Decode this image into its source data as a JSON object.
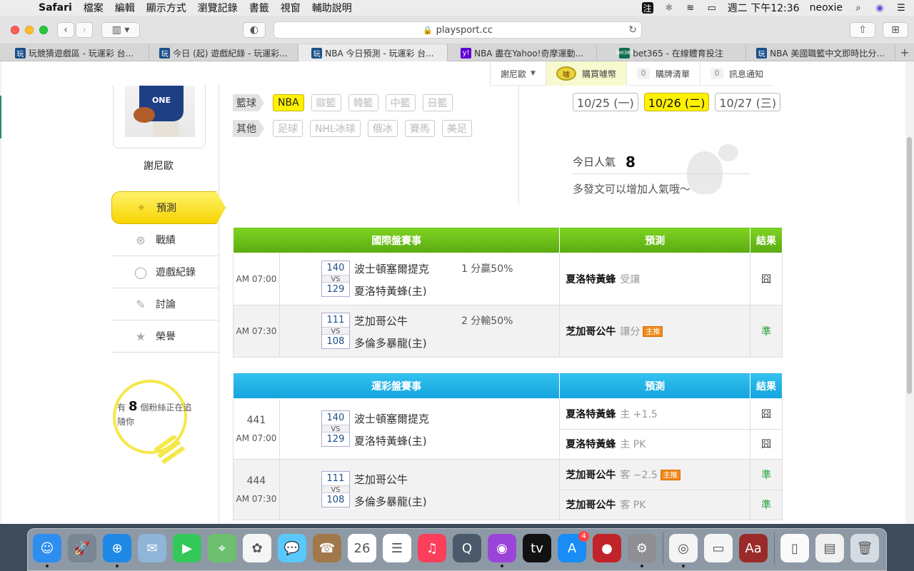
{
  "menubar": {
    "apple": "",
    "app_name": "Safari",
    "items": [
      "檔案",
      "編輯",
      "顯示方式",
      "瀏覽記錄",
      "書籤",
      "視窗",
      "輔助說明"
    ],
    "input_method": "注",
    "datetime": "週二 下午12:36",
    "user": "neoxie"
  },
  "browser": {
    "url": "playsport.cc",
    "tabs": [
      {
        "label": "玩競猜遊戲區 - 玩運彩 台...",
        "favicon": "wan-icon",
        "favicon_text": "玩"
      },
      {
        "label": "今日 (起) 遊戲紀錄 - 玩運彩...",
        "favicon": "wan-icon",
        "favicon_text": "玩"
      },
      {
        "label": "NBA 今日預測 - 玩運彩 台...",
        "favicon": "wan-icon",
        "favicon_text": "玩",
        "active": true
      },
      {
        "label": "NBA 盡在Yahoo!奇摩運動...",
        "favicon": "yahoo-icon",
        "favicon_text": "y!"
      },
      {
        "label": "bet365 - 在線體育投注",
        "favicon": "bet365-icon",
        "favicon_text": "bet365"
      },
      {
        "label": "NBA 美國職籃中文即時比分...",
        "favicon": "wan-icon",
        "favicon_text": "玩"
      }
    ]
  },
  "userbar": {
    "username": "謝尼歐",
    "buy_coins": "購買噱幣",
    "coin_icon_text": "噱",
    "cart_count": "0",
    "cart_label": "購牌清單",
    "notice_count": "0",
    "notice_label": "訊息通知"
  },
  "sidebar": {
    "jersey_text": "ONE",
    "username": "謝尼歐",
    "nav": [
      {
        "label": "預測",
        "icon": "target-icon",
        "active": true
      },
      {
        "label": "戰績",
        "icon": "record-icon"
      },
      {
        "label": "遊戲紀錄",
        "icon": "circle-icon"
      },
      {
        "label": "討論",
        "icon": "discuss-icon"
      },
      {
        "label": "榮譽",
        "icon": "medal-icon"
      }
    ],
    "fans": {
      "prefix": "有",
      "count": "8",
      "suffix": "個粉絲正在追隨你"
    }
  },
  "filters": {
    "basketball": {
      "category": "籃球",
      "items": [
        "NBA",
        "歐籃",
        "韓籃",
        "中籃",
        "日籃"
      ],
      "active": "NBA"
    },
    "other": {
      "category": "其他",
      "items": [
        "足球",
        "NHL冰球",
        "俄冰",
        "賽馬",
        "美足"
      ]
    }
  },
  "dates": [
    {
      "label": "10/25 (一)"
    },
    {
      "label": "10/26 (二)",
      "active": true
    },
    {
      "label": "10/27 (三)"
    }
  ],
  "popularity": {
    "label": "今日人氣",
    "value": "8",
    "hint": "多發文可以增加人氣哦～"
  },
  "intl_table": {
    "headers": [
      "國際盤賽事",
      "預測",
      "結果"
    ],
    "rows": [
      {
        "time": "AM 07:00",
        "score1": "140",
        "score2": "129",
        "vs": "VS",
        "team1": "波士頓塞爾提克",
        "team2": "夏洛特黃蜂(主)",
        "odds": "1 分贏50%",
        "pred_team": "夏洛特黃蜂",
        "pred_detail": "受讓",
        "main": false,
        "result": "囧"
      },
      {
        "time": "AM 07:30",
        "score1": "111",
        "score2": "108",
        "vs": "VS",
        "team1": "芝加哥公牛",
        "team2": "多倫多暴龍(主)",
        "odds": "2 分輸50%",
        "pred_team": "芝加哥公牛",
        "pred_detail": "讓分",
        "main": true,
        "main_label": "主推",
        "result": "準"
      }
    ]
  },
  "lottery_table": {
    "headers": [
      "運彩盤賽事",
      "預測",
      "結果"
    ],
    "rows": [
      {
        "game_no": "441",
        "time": "AM 07:00",
        "score1": "140",
        "score2": "129",
        "vs": "VS",
        "team1": "波士頓塞爾提克",
        "team2": "夏洛特黃蜂(主)",
        "preds": [
          {
            "team": "夏洛特黃蜂",
            "detail": "主 +1.5",
            "main": false,
            "result": "囧"
          },
          {
            "team": "夏洛特黃蜂",
            "detail": "主 PK",
            "main": false,
            "result": "囧"
          }
        ]
      },
      {
        "game_no": "444",
        "time": "AM 07:30",
        "score1": "111",
        "score2": "108",
        "vs": "VS",
        "team1": "芝加哥公牛",
        "team2": "多倫多暴龍(主)",
        "preds": [
          {
            "team": "芝加哥公牛",
            "detail": "客 −2.5",
            "main": true,
            "main_label": "主推",
            "result": "準"
          },
          {
            "team": "芝加哥公牛",
            "detail": "客 PK",
            "main": false,
            "result": "準"
          }
        ]
      }
    ]
  },
  "dock": {
    "apps": [
      {
        "name": "finder-icon",
        "color": "#2d8ef0",
        "glyph": "☺",
        "running": true
      },
      {
        "name": "launchpad-icon",
        "color": "#7a8694",
        "glyph": "🚀",
        "running": false
      },
      {
        "name": "safari-icon",
        "color": "#1e88e5",
        "glyph": "⊕",
        "running": true
      },
      {
        "name": "mail-icon",
        "color": "#8fb6d9",
        "glyph": "✉",
        "running": false
      },
      {
        "name": "facetime-icon",
        "color": "#34c759",
        "glyph": "▶",
        "running": false
      },
      {
        "name": "maps-icon",
        "color": "#6cc070",
        "glyph": "⌖",
        "running": false
      },
      {
        "name": "photos-icon",
        "color": "#f5f5f5",
        "glyph": "✿",
        "running": false
      },
      {
        "name": "messages-icon",
        "color": "#5ac8fa",
        "glyph": "💬",
        "running": false
      },
      {
        "name": "contacts-icon",
        "color": "#a0784a",
        "glyph": "☎",
        "running": false
      },
      {
        "name": "calendar-icon",
        "color": "#ffffff",
        "glyph": "26",
        "running": false
      },
      {
        "name": "reminders-icon",
        "color": "#ffffff",
        "glyph": "☰",
        "running": false
      },
      {
        "name": "music-icon",
        "color": "#fa3e5c",
        "glyph": "♫",
        "running": false
      },
      {
        "name": "quicktime-icon",
        "color": "#4a5a6a",
        "glyph": "Q",
        "running": false
      },
      {
        "name": "podcasts-icon",
        "color": "#9b45d8",
        "glyph": "◉",
        "running": true
      },
      {
        "name": "tv-icon",
        "color": "#111111",
        "glyph": "tv",
        "running": false
      },
      {
        "name": "appstore-icon",
        "color": "#1a8cf5",
        "glyph": "A",
        "running": false,
        "badge": "4"
      },
      {
        "name": "photo-booth-icon",
        "color": "#c0232a",
        "glyph": "●",
        "running": false
      },
      {
        "name": "system-preferences-icon",
        "color": "#8e8e93",
        "glyph": "⚙",
        "running": true
      },
      {
        "name": "chrome-icon",
        "color": "#f4f4f4",
        "glyph": "◎",
        "running": true
      },
      {
        "name": "textedit-icon",
        "color": "#f5f5f5",
        "glyph": "▭",
        "running": false
      },
      {
        "name": "dictionary-icon",
        "color": "#9b2a2a",
        "glyph": "Aa",
        "running": false
      },
      {
        "name": "document-icon",
        "color": "#fafafa",
        "glyph": "▯",
        "running": false
      },
      {
        "name": "downloads-stack-icon",
        "color": "#f0f0f0",
        "glyph": "▤",
        "running": false
      },
      {
        "name": "trash-icon",
        "color": "#d5dbe2",
        "glyph": "🗑",
        "running": false
      }
    ]
  }
}
